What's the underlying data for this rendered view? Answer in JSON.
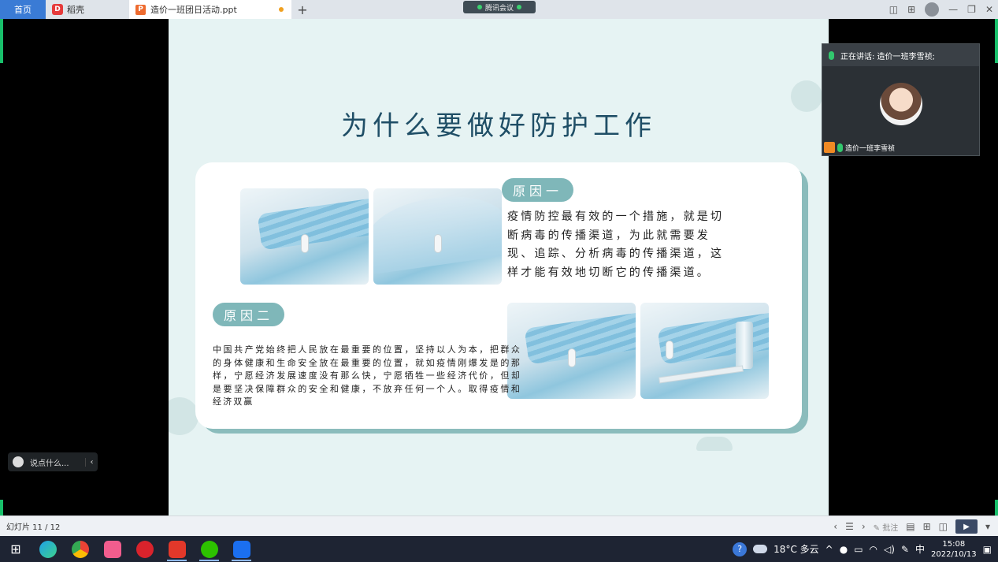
{
  "window": {
    "tabs": [
      {
        "label": "首页"
      },
      {
        "label": "稻壳",
        "icon": "daoke-logo-icon"
      },
      {
        "label": "造价一班团日活动.ppt",
        "icon": "ppt-file-icon"
      }
    ],
    "meeting_label": "腾讯会议"
  },
  "slide": {
    "title": "为什么要做好防护工作",
    "reason1": {
      "label": "原因一",
      "text": "疫情防控最有效的一个措施，就是切断病毒的传播渠道，为此就需要发现、追踪、分析病毒的传播渠道，这样才能有效地切断它的传播渠道。"
    },
    "reason2": {
      "label": "原因二",
      "text": "中国共产党始终把人民放在最重要的位置，坚持以人为本，把群众的身体健康和生命安全放在最重要的位置，就如疫情刚爆发是的那样，宁愿经济发展速度没有那么快，宁愿牺牲一些经济代价，但却是要坚决保障群众的安全和健康，不放弃任何一个人。取得疫情和经济双赢"
    }
  },
  "video": {
    "speaking": "正在讲话: 造价一班李雪祯;",
    "participant": "造价一班李雪祯"
  },
  "chat": {
    "placeholder": "说点什么..."
  },
  "statusbar": {
    "slide_counter": "幻灯片 11 / 12",
    "annotate": "批注"
  },
  "taskbar": {
    "weather": "18°C 多云",
    "ime": "中",
    "time": "15:08",
    "date": "2022/10/13"
  },
  "colors": {
    "accent": "#7fb7b9",
    "title": "#1f4e66",
    "slide_bg": "#e6f3f3"
  }
}
